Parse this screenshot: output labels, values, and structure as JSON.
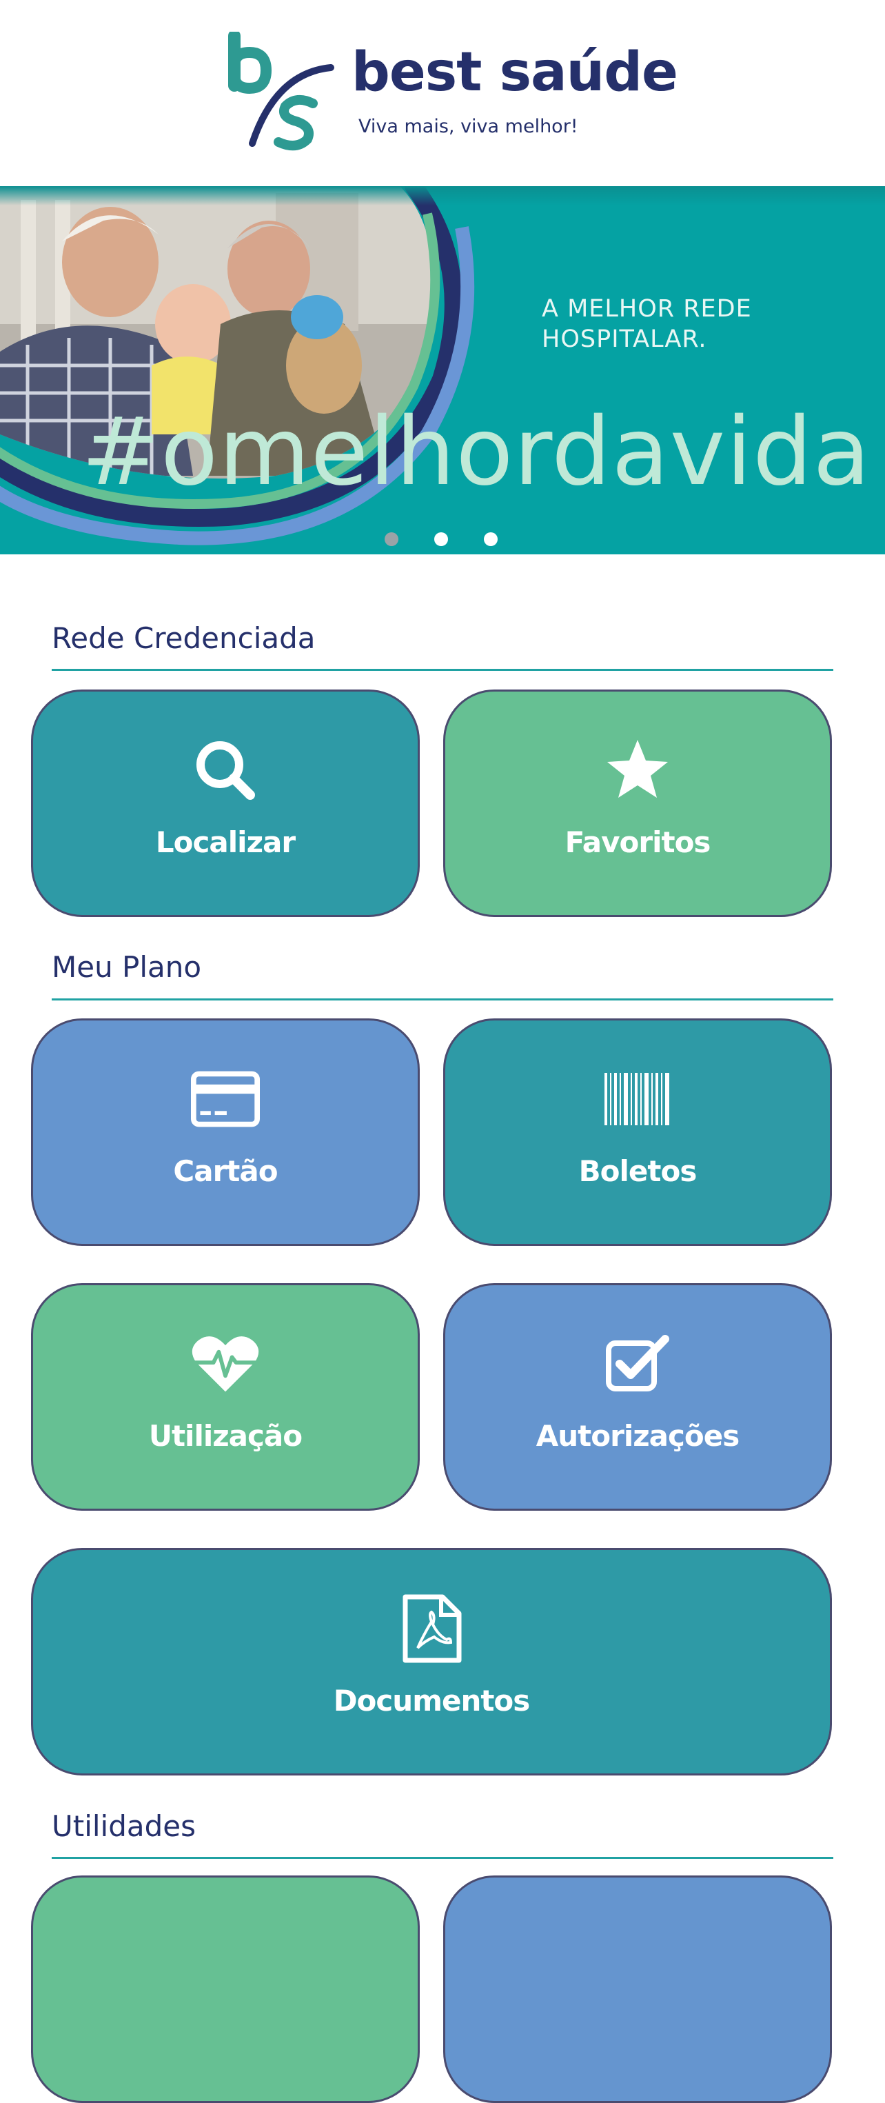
{
  "brand": {
    "name": "best saúde",
    "tagline": "Viva mais, viva melhor!",
    "colors": {
      "navy": "#25306b",
      "teal": "#2e9aa6",
      "green": "#66c093",
      "blue": "#6595cf",
      "banner": "#05a2a3"
    }
  },
  "banner": {
    "headline": "A MELHOR REDE\nHOSPITALAR.",
    "hashtag": "#omelhordavida",
    "slides": 3,
    "active_slide": 1
  },
  "sections": {
    "rede": {
      "title": "Rede Credenciada",
      "tiles": [
        {
          "label": "Localizar",
          "icon": "search-icon",
          "color": "#2e9aa6"
        },
        {
          "label": "Favoritos",
          "icon": "star-icon",
          "color": "#66c093"
        }
      ]
    },
    "plano": {
      "title": "Meu Plano",
      "tiles": [
        {
          "label": "Cartão",
          "icon": "credit-card-icon",
          "color": "#6595cf"
        },
        {
          "label": "Boletos",
          "icon": "barcode-icon",
          "color": "#2e9aa6"
        },
        {
          "label": "Utilização",
          "icon": "heartbeat-icon",
          "color": "#66c093"
        },
        {
          "label": "Autorizações",
          "icon": "checkbox-icon",
          "color": "#6595cf"
        },
        {
          "label": "Documentos",
          "icon": "pdf-file-icon",
          "color": "#2e9aa6"
        }
      ]
    },
    "utilidades": {
      "title": "Utilidades"
    }
  }
}
